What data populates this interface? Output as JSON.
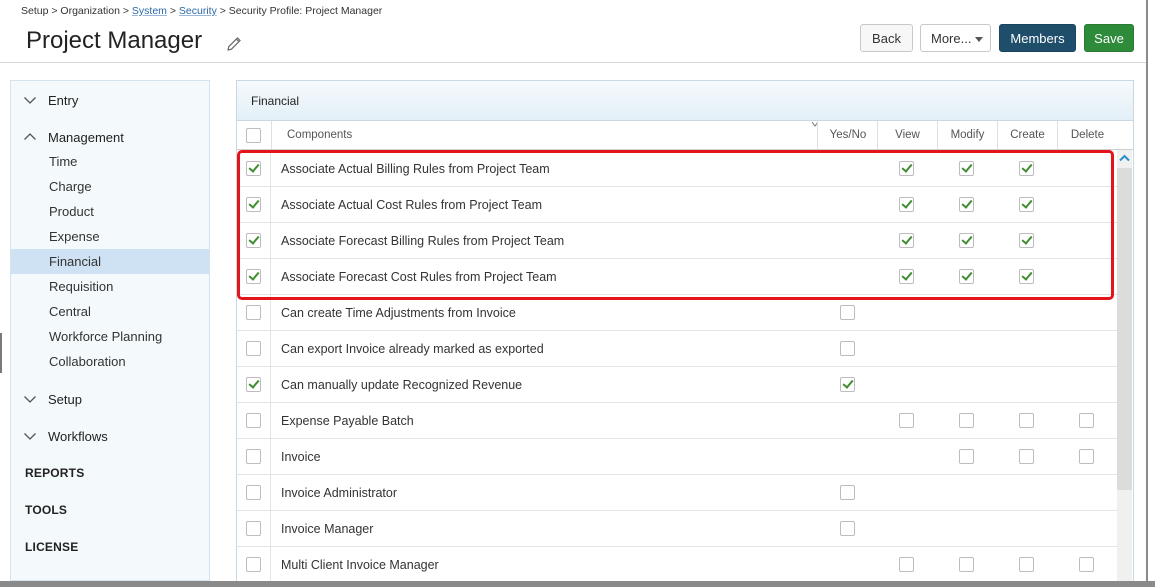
{
  "breadcrumb": {
    "prefix": "Setup > Organization > ",
    "system": "System",
    "sep1": " > ",
    "security": "Security",
    "suffix": " > Security Profile: Project Manager"
  },
  "page_title": "Project Manager",
  "buttons": {
    "back": "Back",
    "more": "More...",
    "members": "Members",
    "save": "Save"
  },
  "sidebar": {
    "sections": [
      {
        "label": "Entry",
        "expanded": false,
        "icon": "chevron-down-icon"
      },
      {
        "label": "Management",
        "expanded": true,
        "icon": "chevron-up-icon"
      },
      {
        "label": "Setup",
        "expanded": false,
        "icon": "chevron-down-icon"
      },
      {
        "label": "Workflows",
        "expanded": false,
        "icon": "chevron-down-icon"
      }
    ],
    "management_items": [
      "Time",
      "Charge",
      "Product",
      "Expense",
      "Financial",
      "Requisition",
      "Central",
      "Workforce Planning",
      "Collaboration"
    ],
    "active_item": "Financial",
    "caps": [
      "REPORTS",
      "TOOLS",
      "LICENSE"
    ]
  },
  "panel": {
    "title": "Financial",
    "columns": {
      "components": "Components",
      "yes_no": "Yes/No",
      "view": "View",
      "modify": "Modify",
      "create": "Create",
      "delete": "Delete"
    },
    "rows": [
      {
        "label": "Associate Actual Billing Rules from Project Team",
        "row_checked": true,
        "yesno": null,
        "view": true,
        "modify": true,
        "create": true,
        "delete": null
      },
      {
        "label": "Associate Actual Cost Rules from Project Team",
        "row_checked": true,
        "yesno": null,
        "view": true,
        "modify": true,
        "create": true,
        "delete": null
      },
      {
        "label": "Associate Forecast Billing Rules from Project Team",
        "row_checked": true,
        "yesno": null,
        "view": true,
        "modify": true,
        "create": true,
        "delete": null
      },
      {
        "label": "Associate Forecast Cost Rules from Project Team",
        "row_checked": true,
        "yesno": null,
        "view": true,
        "modify": true,
        "create": true,
        "delete": null
      },
      {
        "label": "Can create Time Adjustments from Invoice",
        "row_checked": false,
        "yesno": false,
        "view": null,
        "modify": null,
        "create": null,
        "delete": null
      },
      {
        "label": "Can export Invoice already marked as exported",
        "row_checked": false,
        "yesno": false,
        "view": null,
        "modify": null,
        "create": null,
        "delete": null
      },
      {
        "label": "Can manually update Recognized Revenue",
        "row_checked": true,
        "yesno": true,
        "view": null,
        "modify": null,
        "create": null,
        "delete": null
      },
      {
        "label": "Expense Payable Batch",
        "row_checked": false,
        "yesno": null,
        "view": false,
        "modify": false,
        "create": false,
        "delete": false
      },
      {
        "label": "Invoice",
        "row_checked": false,
        "yesno": null,
        "view": null,
        "modify": false,
        "create": false,
        "delete": false
      },
      {
        "label": "Invoice Administrator",
        "row_checked": false,
        "yesno": false,
        "view": null,
        "modify": null,
        "create": null,
        "delete": null
      },
      {
        "label": "Invoice Manager",
        "row_checked": false,
        "yesno": false,
        "view": null,
        "modify": null,
        "create": null,
        "delete": null
      },
      {
        "label": "Multi Client Invoice Manager",
        "row_checked": false,
        "yesno": null,
        "view": false,
        "modify": false,
        "create": false,
        "delete": false
      }
    ]
  },
  "colors": {
    "members_button": "#1f4e6b",
    "save_button": "#2e8b3a",
    "highlight_border": "#e3151b",
    "check_green": "#3f8d2f",
    "active_sidebar": "#cfe2f3"
  }
}
